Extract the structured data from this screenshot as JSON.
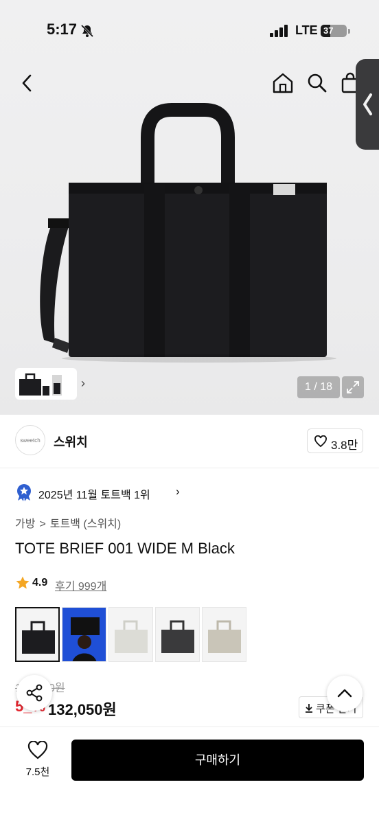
{
  "status_bar": {
    "time": "5:17",
    "network": "LTE",
    "battery": "37",
    "battery_level": 0.37
  },
  "gallery": {
    "page_counter": "1 / 18"
  },
  "brand": {
    "logo_text": "sweetch",
    "name": "스위치",
    "like_count": "3.8만"
  },
  "ranking": {
    "text": "2025년 11월 토트백 1위"
  },
  "breadcrumb": {
    "items": [
      "가방",
      ">",
      "토트백 (스위치)"
    ]
  },
  "product": {
    "title": "TOTE BRIEF 001 WIDE M Black",
    "rating": "4.9",
    "review_link": "후기 999개",
    "original_price": "1__,_00원",
    "discount": "5_%",
    "sale_price": "132,050원",
    "coupon_label": "쿠폰 받기"
  },
  "bottom_bar": {
    "wish_count": "7.5천",
    "buy_label": "구매하기"
  },
  "colors": {
    "accent": "#000000",
    "discount": "#e3262f",
    "rating_star": "#f4a623"
  },
  "icons": [
    "bell-off-icon",
    "signal-icon",
    "back-icon",
    "home-icon",
    "search-icon",
    "cart-icon",
    "chevron-left-icon",
    "expand-icon",
    "heart-icon",
    "badge-icon",
    "star-icon",
    "share-icon",
    "chevron-up-icon",
    "download-icon"
  ]
}
